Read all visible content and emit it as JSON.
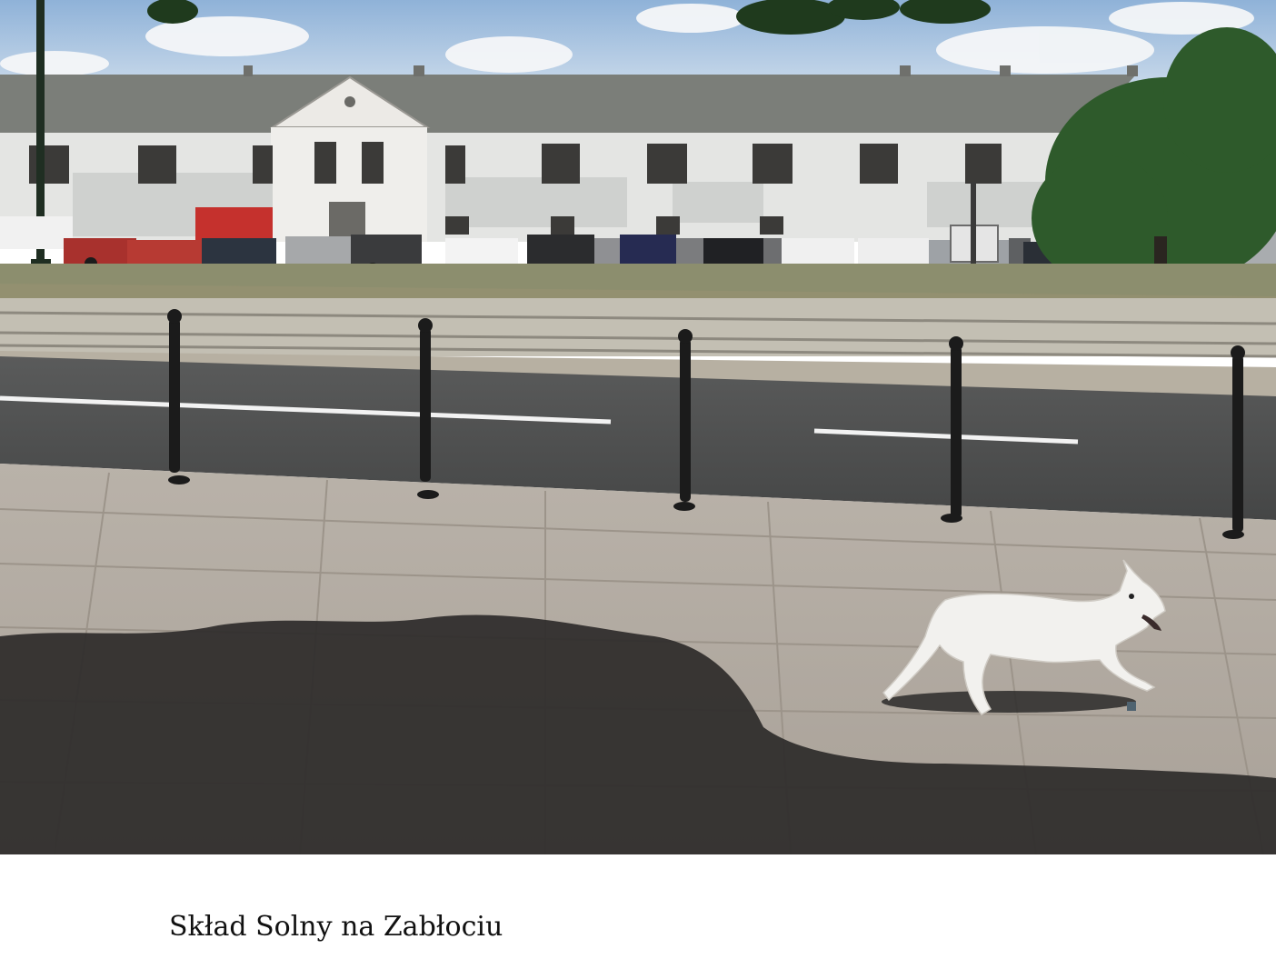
{
  "figure": {
    "caption": "Skład Solny na Zabłociu",
    "colors": {
      "sky": "#bcd0e6",
      "roof": "#7c7f7a",
      "wall": "#e5e6e4",
      "grass": "#8d8f6e",
      "road": "#4c4d4d",
      "pavement": "#b8b0a6",
      "shadow": "#2f2d2c",
      "bollard": "#1d1d1d",
      "dog": "#f3f2ef",
      "tree": "#2f5b2c"
    }
  }
}
